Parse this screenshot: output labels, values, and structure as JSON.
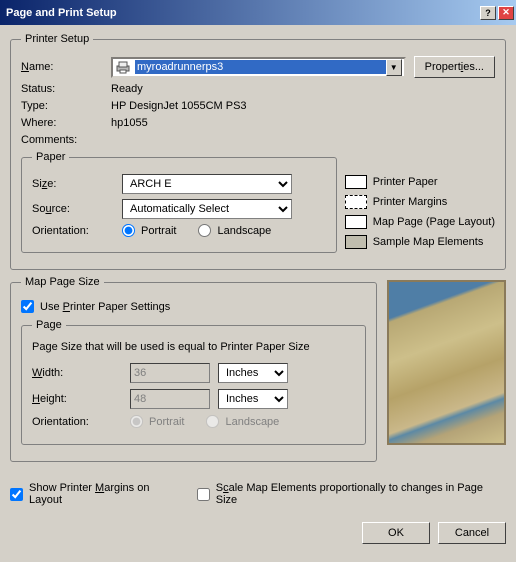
{
  "title": "Page and Print Setup",
  "printerSetup": {
    "legend": "Printer Setup",
    "nameLabel": "Name:",
    "nameLabelU": "N",
    "nameValue": "myroadrunnerps3",
    "propertiesBtn": "Properties...",
    "propertiesBtnU": "i",
    "statusLabel": "Status:",
    "statusValue": "Ready",
    "typeLabel": "Type:",
    "typeValue": "HP DesignJet 1055CM PS3",
    "whereLabel": "Where:",
    "whereValue": "hp1055",
    "commentsLabel": "Comments:",
    "commentsValue": ""
  },
  "paper": {
    "legend": "Paper",
    "sizeLabel": "Size:",
    "sizeLabelU": "z",
    "sizeValue": "ARCH E",
    "sourceLabel": "Source:",
    "sourceLabelU": "u",
    "sourceValue": "Automatically Select",
    "orientationLabel": "Orientation:",
    "portrait": "Portrait",
    "landscape": "Landscape"
  },
  "legendLabels": {
    "printerPaper": "Printer Paper",
    "printerMargins": "Printer Margins",
    "mapPage": "Map Page (Page Layout)",
    "sampleElements": "Sample Map Elements"
  },
  "mapPageSize": {
    "legend": "Map Page Size",
    "usePrinterSettings": "Use Printer Paper Settings",
    "usePrinterSettingsU": "P"
  },
  "page": {
    "legend": "Page",
    "info": "Page Size that will be used is equal to Printer Paper Size",
    "widthLabel": "Width:",
    "widthLabelU": "W",
    "widthValue": "36",
    "widthUnit": "Inches",
    "heightLabel": "Height:",
    "heightLabelU": "H",
    "heightValue": "48",
    "heightUnit": "Inches",
    "orientationLabel": "Orientation:",
    "portrait": "Portrait",
    "landscape": "Landscape"
  },
  "footer": {
    "showMargins": "Show Printer Margins on Layout",
    "showMarginsU": "M",
    "scaleElements": "Scale Map Elements proportionally to changes in Page Size",
    "scaleElementsU": "c",
    "ok": "OK",
    "cancel": "Cancel"
  }
}
